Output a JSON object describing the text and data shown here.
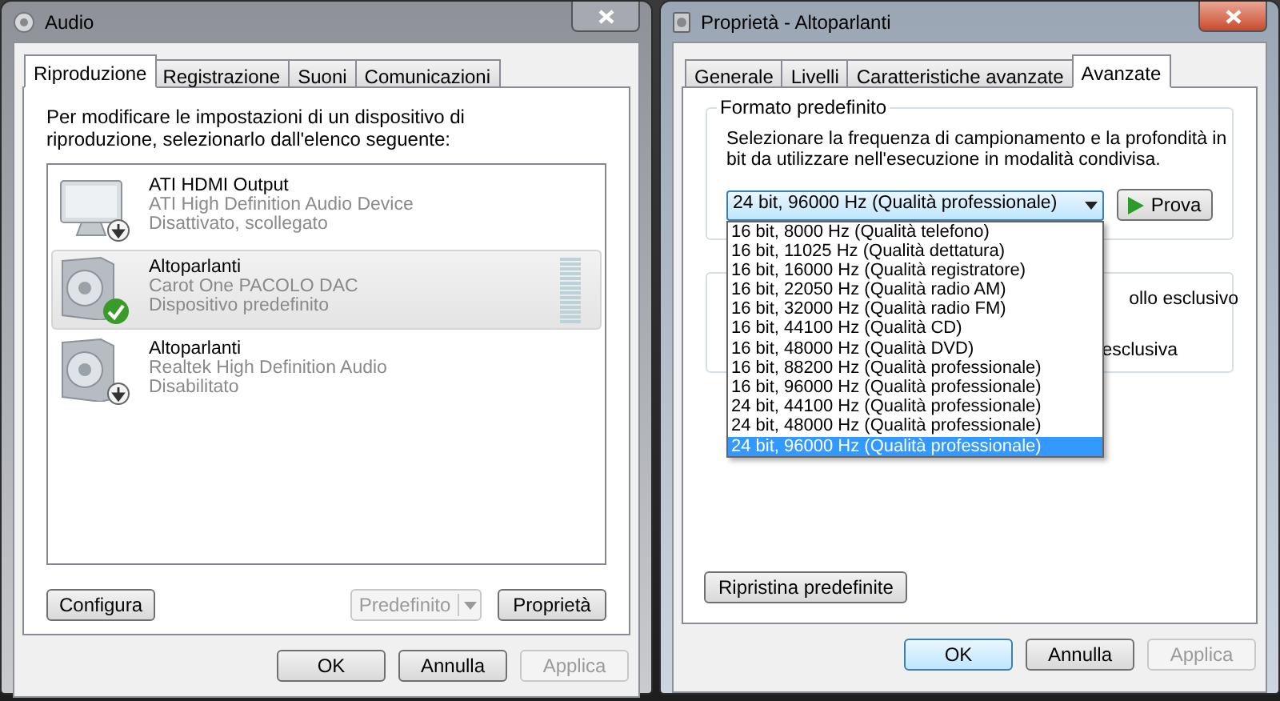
{
  "audio_window": {
    "title": "Audio",
    "tabs": [
      {
        "label": "Riproduzione",
        "selected": true
      },
      {
        "label": "Registrazione",
        "selected": false
      },
      {
        "label": "Suoni",
        "selected": false
      },
      {
        "label": "Comunicazioni",
        "selected": false
      }
    ],
    "instructions": "Per modificare le impostazioni di un dispositivo di riproduzione, selezionarlo dall'elenco seguente:",
    "devices": [
      {
        "kind": "monitor",
        "name": "ATI HDMI Output",
        "driver": "ATI High Definition Audio Device",
        "status": "Disattivato, scollegato",
        "default": false,
        "selected": false
      },
      {
        "kind": "speaker",
        "name": "Altoparlanti",
        "driver": "Carot One PACOLO DAC",
        "status": "Dispositivo predefinito",
        "default": true,
        "selected": true
      },
      {
        "kind": "speaker",
        "name": "Altoparlanti",
        "driver": "Realtek High Definition Audio",
        "status": "Disabilitato",
        "default": false,
        "selected": false
      }
    ],
    "list_buttons": [
      {
        "label": "Configura",
        "disabled": false,
        "split": false
      },
      {
        "label": "Predefinito",
        "disabled": true,
        "split": true
      },
      {
        "label": "Proprietà",
        "disabled": false,
        "split": false
      }
    ],
    "buttons": [
      {
        "label": "OK",
        "disabled": false,
        "focused": false
      },
      {
        "label": "Annulla",
        "disabled": false,
        "focused": false
      },
      {
        "label": "Applica",
        "disabled": true,
        "focused": false
      }
    ]
  },
  "properties_window": {
    "title": "Proprietà - Altoparlanti",
    "tabs": [
      {
        "label": "Generale",
        "selected": false
      },
      {
        "label": "Livelli",
        "selected": false
      },
      {
        "label": "Caratteristiche avanzate",
        "selected": false
      },
      {
        "label": "Avanzate",
        "selected": true
      }
    ],
    "format_group": {
      "title": "Formato predefinito",
      "description": "Selezionare la frequenza di campionamento e la profondità in bit da utilizzare nell'esecuzione in modalità condivisa.",
      "value": "24 bit, 96000 Hz (Qualità professionale)",
      "test_button": "Prova",
      "options": [
        {
          "label": "16 bit, 8000 Hz (Qualità telefono)",
          "selected": false
        },
        {
          "label": "16 bit, 11025 Hz (Qualità dettatura)",
          "selected": false
        },
        {
          "label": "16 bit, 16000 Hz (Qualità registratore)",
          "selected": false
        },
        {
          "label": "16 bit, 22050 Hz (Qualità radio AM)",
          "selected": false
        },
        {
          "label": "16 bit, 32000 Hz (Qualità radio FM)",
          "selected": false
        },
        {
          "label": "16 bit, 44100 Hz (Qualità CD)",
          "selected": false
        },
        {
          "label": "16 bit, 48000 Hz (Qualità DVD)",
          "selected": false
        },
        {
          "label": "16 bit, 88200 Hz (Qualità professionale)",
          "selected": false
        },
        {
          "label": "16 bit, 96000 Hz (Qualità professionale)",
          "selected": false
        },
        {
          "label": "24 bit, 44100 Hz (Qualità professionale)",
          "selected": false
        },
        {
          "label": "24 bit, 48000 Hz (Qualità professionale)",
          "selected": false
        },
        {
          "label": "24 bit, 96000 Hz (Qualità professionale)",
          "selected": true
        }
      ]
    },
    "exclusive_group_fragments": [
      "ollo esclusivo",
      "esclusiva"
    ],
    "restore_button": "Ripristina predefinite",
    "buttons": [
      {
        "label": "OK",
        "disabled": false,
        "focused": true
      },
      {
        "label": "Annulla",
        "disabled": false,
        "focused": false
      },
      {
        "label": "Applica",
        "disabled": true,
        "focused": false
      }
    ]
  }
}
